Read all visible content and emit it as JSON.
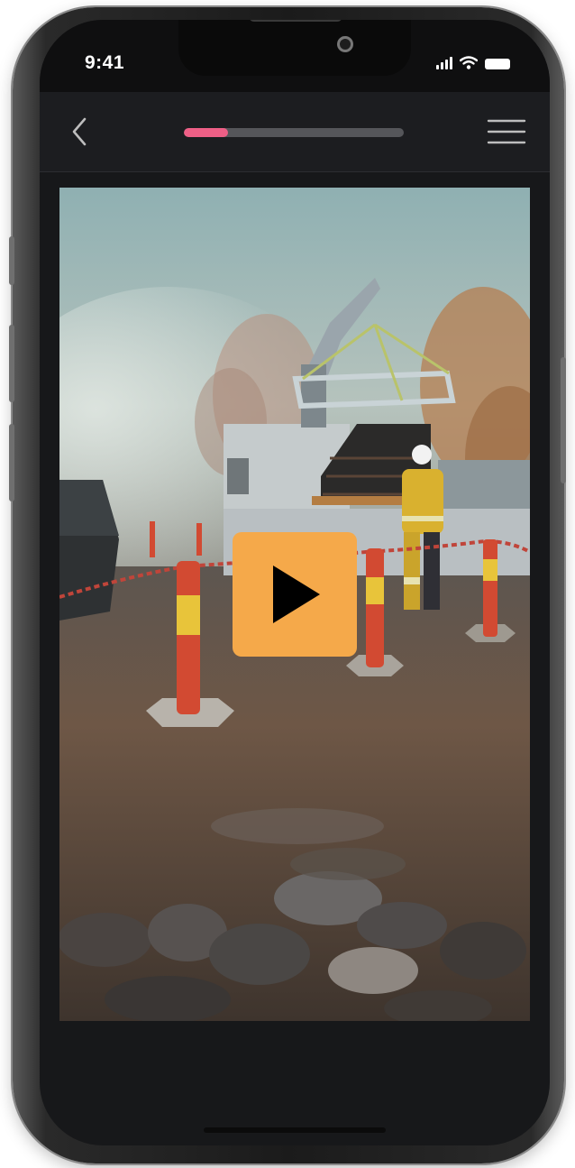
{
  "status_bar": {
    "time": "9:41",
    "icons": [
      "signal-icon",
      "wifi-icon",
      "battery-icon"
    ]
  },
  "nav": {
    "back_icon": "chevron-left-icon",
    "progress_fraction": 0.2,
    "menu_icon": "hamburger-menu-icon"
  },
  "video": {
    "thumbnail": "construction-site-scene",
    "play_icon": "play-icon"
  },
  "colors": {
    "progress_fill": "#ee5f86",
    "progress_track": "#55565a",
    "play_button": "#f5a94a",
    "screen_background": "#17181a"
  }
}
